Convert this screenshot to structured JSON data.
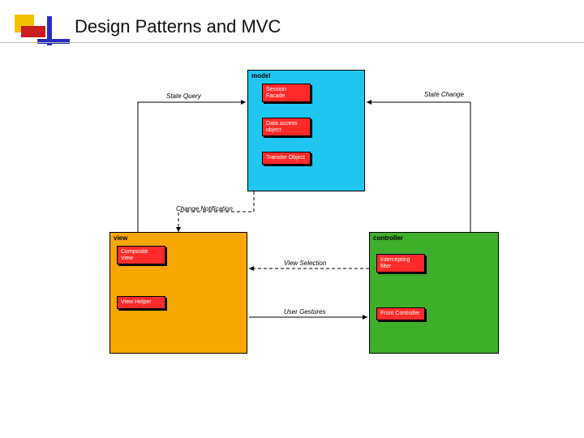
{
  "title": "Design Patterns and MVC",
  "model": {
    "label": "model",
    "patterns": {
      "session_facade": "Session\nFacade",
      "data_access": "Data access\nobject",
      "transfer": "Transfer\nObject"
    }
  },
  "view": {
    "label": "view",
    "patterns": {
      "composite": "Composite\nView",
      "helper": "View Helper"
    }
  },
  "controller": {
    "label": "controller",
    "patterns": {
      "intercepting": "Intercepting\nfilter",
      "front": "Front\nController"
    }
  },
  "edges": {
    "state_query": "State Query",
    "state_change": "State Change",
    "change_notification": "Change Notification",
    "view_selection": "View Selection",
    "user_gestures": "User Gestures"
  }
}
